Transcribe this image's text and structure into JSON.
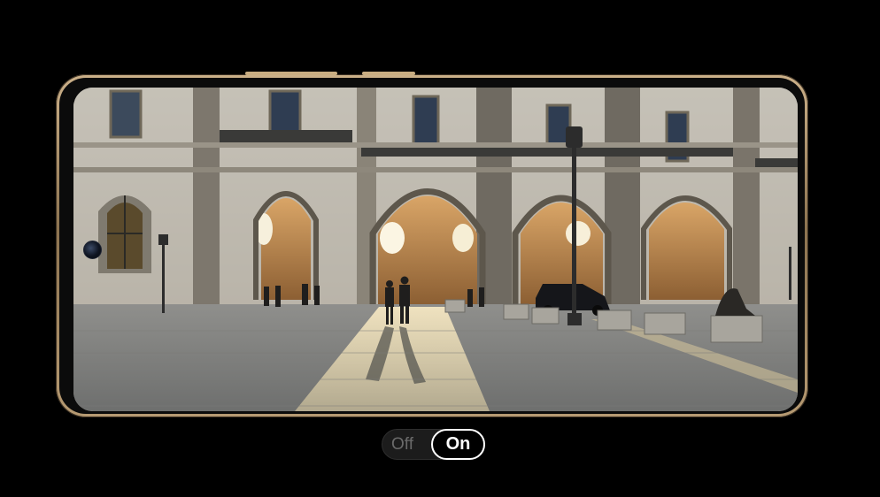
{
  "toggle": {
    "off_label": "Off",
    "on_label": "On",
    "selected": "On"
  },
  "colors": {
    "background": "#000000",
    "frame_gold": "#b69a72",
    "toggle_active_border": "#ffffff",
    "toggle_inactive_text": "#6a6a6a"
  },
  "icons": {
    "front_camera": "camera-lens-icon"
  }
}
